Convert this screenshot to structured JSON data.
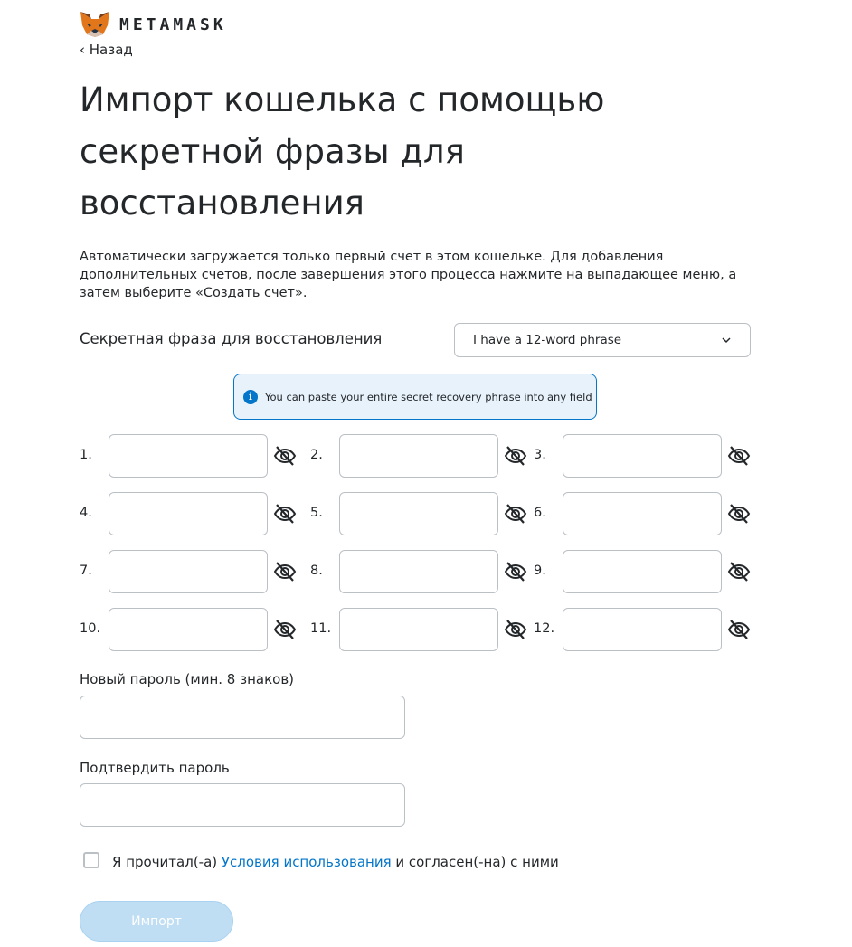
{
  "brand": "METAMASK",
  "back": "‹ Назад",
  "title": "Импорт кошелька с помощью секретной фразы для восстановления",
  "description": "Автоматически загружается только первый счет в этом кошельке. Для добавления дополнительных счетов, после завершения этого процесса нажмите на выпадающее меню, а затем выберите «Создать счет».",
  "srp_label": "Секретная фраза для восстановления",
  "phrase_select": {
    "value": "I have a 12-word phrase"
  },
  "info_text": "You can paste your entire secret recovery phrase into any field",
  "words": [
    "1.",
    "2.",
    "3.",
    "4.",
    "5.",
    "6.",
    "7.",
    "8.",
    "9.",
    "10.",
    "11.",
    "12."
  ],
  "new_password_label": "Новый пароль (мин. 8 знаков)",
  "confirm_password_label": "Подтвердить пароль",
  "terms": {
    "prefix": "Я прочитал(-а) ",
    "link": "Условия использования",
    "suffix": " и согласен(-на) с ними",
    "checked": false
  },
  "import_button": "Импорт",
  "colors": {
    "accent": "#0376c9",
    "button_disabled": "#bfdef4",
    "info_bg": "#e7f2fb"
  }
}
